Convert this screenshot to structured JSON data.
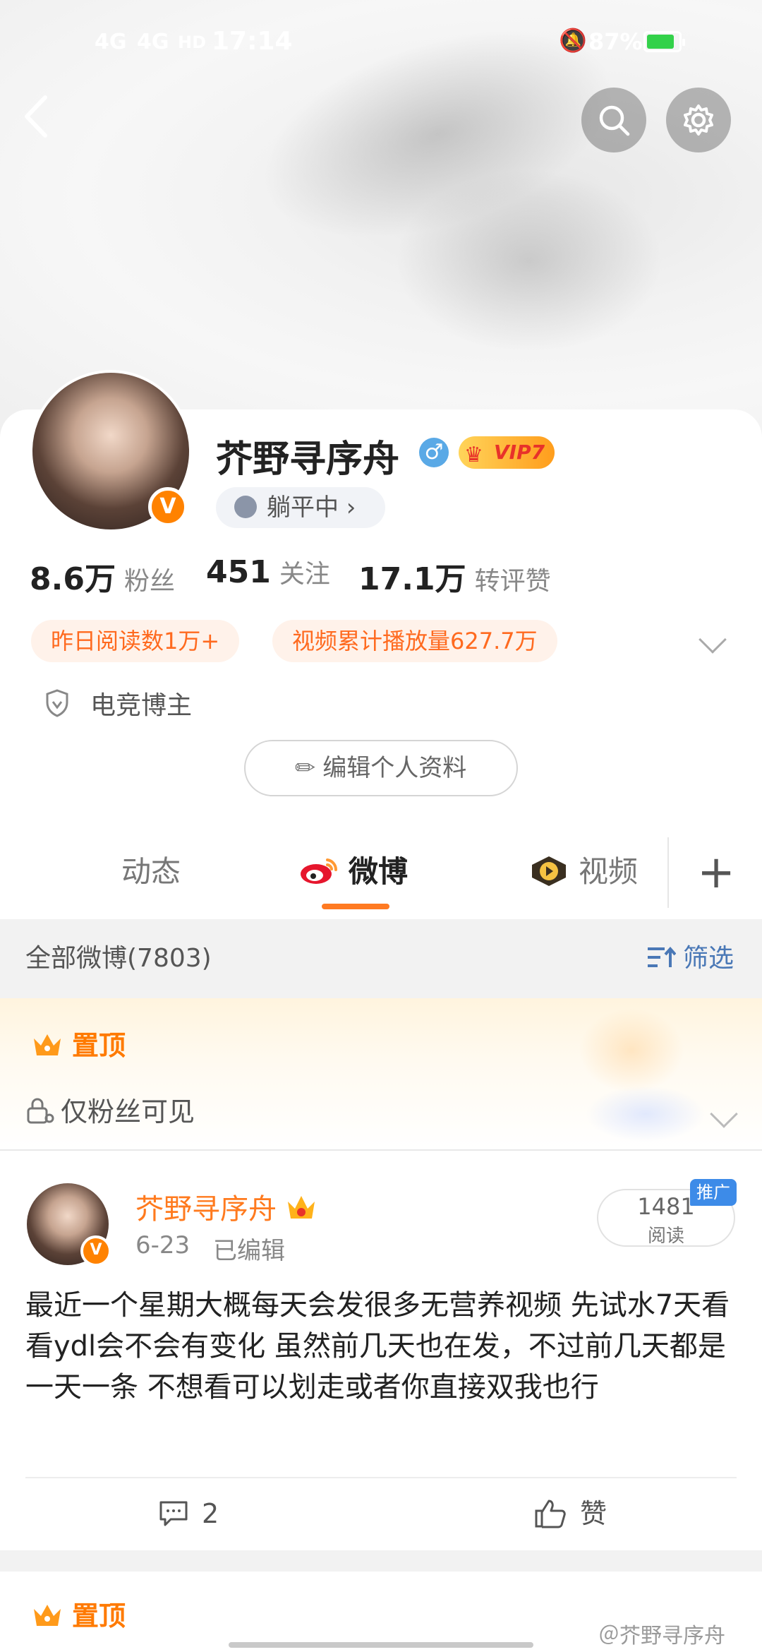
{
  "status_bar": {
    "signal1": "4G",
    "signal2": "4G",
    "hd": "HD",
    "time": "17:14",
    "battery_pct": "87%",
    "battery_level": 0.87
  },
  "profile": {
    "name": "芥野寻序舟",
    "vip": "VIP7",
    "status_chip": "躺平中 ›",
    "stats": {
      "fans_num": "8.6万",
      "fans_lbl": "粉丝",
      "follow_num": "451",
      "follow_lbl": "关注",
      "repost_num": "17.1万",
      "repost_lbl": "转评赞"
    },
    "pills": {
      "read": "昨日阅读数1万+",
      "video": "视频累计播放量627.7万"
    },
    "cert": "电竞博主",
    "edit_label": "编辑个人资料"
  },
  "tabs": {
    "items": [
      {
        "label": "动态"
      },
      {
        "label": "微博"
      },
      {
        "label": "视频"
      }
    ],
    "active": "微博"
  },
  "filter_bar": {
    "all_label": "全部微博(7803)",
    "filter_label": "筛选"
  },
  "pinned": {
    "label": "置顶",
    "visibility": "仅粉丝可见"
  },
  "post": {
    "author": "芥野寻序舟",
    "date": "6-23",
    "edited": "已编辑",
    "reads": "1481",
    "reads_lbl": "阅读",
    "promo": "推广",
    "text": "最近一个星期大概每天会发很多无营养视频 先试水7天看看ydl会不会有变化 虽然前几天也在发，不过前几天都是一天一条 不想看可以划走或者你直接双我也行",
    "comments": "2",
    "like_label": "赞"
  },
  "pinned2": {
    "label": "置顶"
  },
  "watermark": "＠芥野寻序舟",
  "colors": {
    "accent": "#ff7a22",
    "vip_orange": "#ff8200",
    "link_blue": "#4a78b6"
  }
}
